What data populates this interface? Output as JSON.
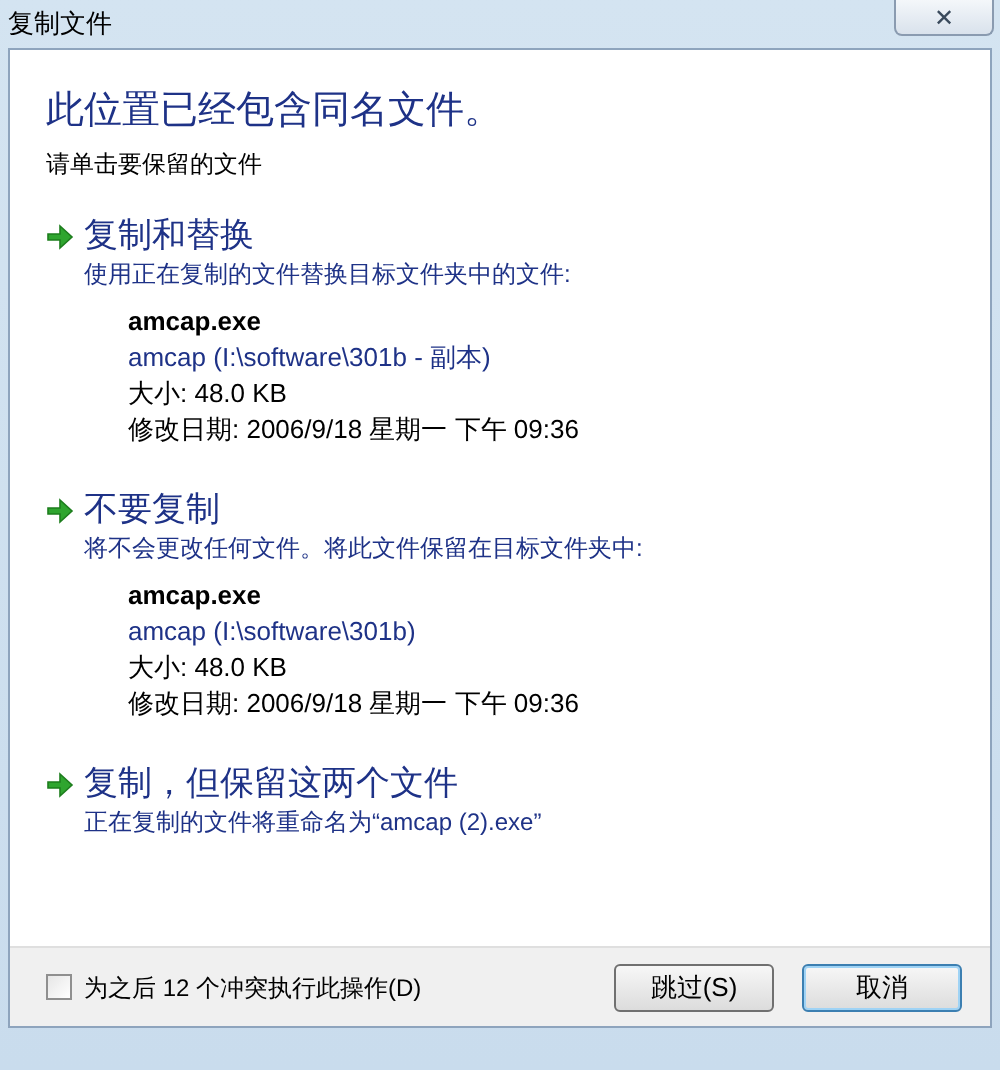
{
  "window": {
    "title": "复制文件",
    "close": "✕"
  },
  "heading": "此位置已经包含同名文件。",
  "instruction": "请单击要保留的文件",
  "options": [
    {
      "title": "复制和替换",
      "description": "使用正在复制的文件替换目标文件夹中的文件:",
      "file": {
        "name": "amcap.exe",
        "location": "amcap (I:\\software\\301b - 副本)",
        "size": "大小: 48.0 KB",
        "modified": "修改日期: 2006/9/18 星期一 下午 09:36"
      }
    },
    {
      "title": "不要复制",
      "description": "将不会更改任何文件。将此文件保留在目标文件夹中:",
      "file": {
        "name": "amcap.exe",
        "location": "amcap (I:\\software\\301b)",
        "size": "大小: 48.0 KB",
        "modified": "修改日期: 2006/9/18 星期一 下午 09:36"
      }
    },
    {
      "title": "复制，但保留这两个文件",
      "description": "正在复制的文件将重命名为“amcap (2).exe”"
    }
  ],
  "apply_all": {
    "label": "为之后 12 个冲突执行此操作(D)",
    "checked": false
  },
  "buttons": [
    {
      "label": "跳过(S)",
      "focused": false
    },
    {
      "label": "取消",
      "focused": true
    }
  ]
}
